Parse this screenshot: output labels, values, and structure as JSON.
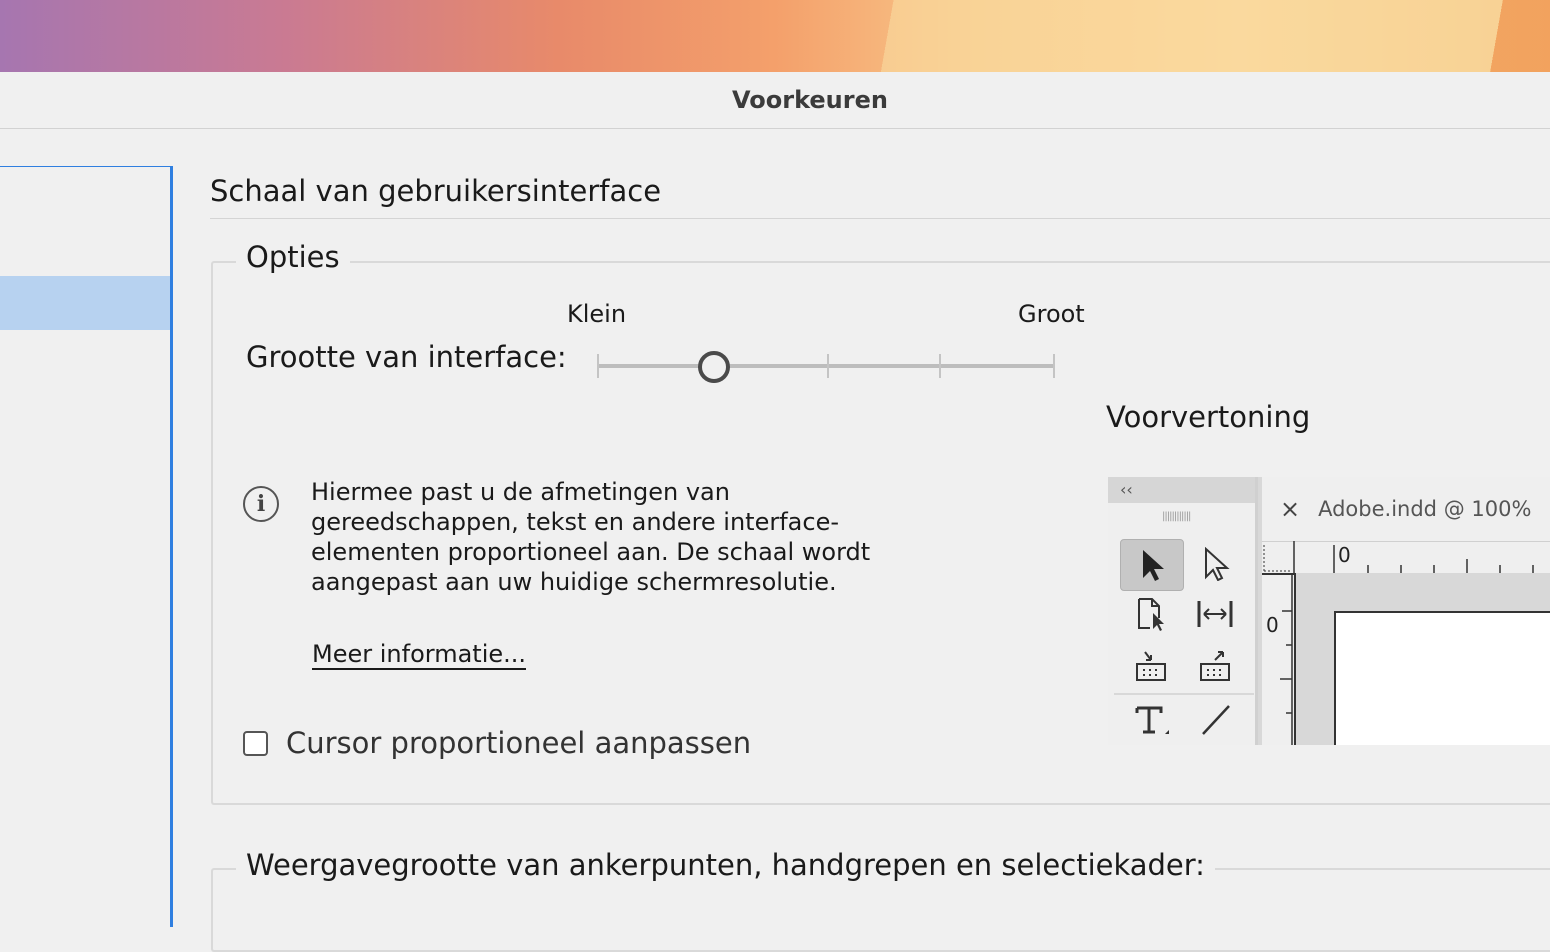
{
  "window": {
    "title": "Voorkeuren"
  },
  "section": {
    "title": "Schaal van gebruikersinterface"
  },
  "options": {
    "legend": "Opties",
    "slider": {
      "label": "Grootte van interface:",
      "min_label": "Klein",
      "max_label": "Groot",
      "value_index": 1,
      "step_count": 5
    },
    "preview_label": "Voorvertoning",
    "info": {
      "icon": "info-icon",
      "text": "Hiermee past u de afmetingen van gereedschappen, tekst en andere interface-elementen proportioneel aan. De schaal wordt aangepast aan uw huidige schermresolutie.",
      "link": "Meer informatie..."
    },
    "checkbox": {
      "label": "Cursor proportioneel aanpassen",
      "checked": false
    }
  },
  "preview": {
    "panel_collapse": "‹‹",
    "tab_close": "×",
    "tab_title": "Adobe.indd @ 100%",
    "ruler_h": "0",
    "ruler_v": "0"
  },
  "section2": {
    "legend": "Weergavegrootte van ankerpunten, handgrepen en selectiekader:"
  }
}
